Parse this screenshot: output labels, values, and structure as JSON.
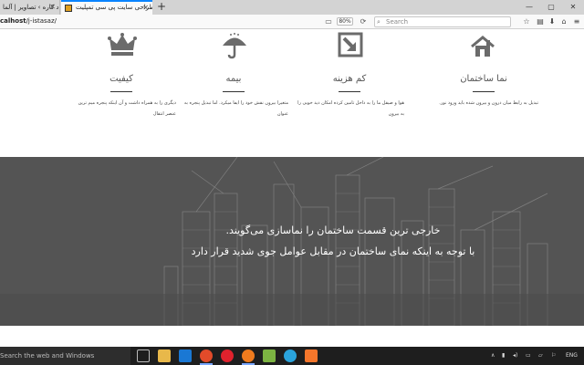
{
  "browser": {
    "tabs": [
      {
        "label": "ایجاد کاره › تصاویر | آلما"
      },
      {
        "label": "طراحی سایت پی سی تمپلیت"
      }
    ],
    "new_tab_symbol": "+",
    "window_controls": [
      "—",
      "▢",
      "✕"
    ],
    "url_bold": "calhost",
    "url_rest": "/j-istasaz/",
    "zoom": "80%",
    "search_placeholder": "Search"
  },
  "features": [
    {
      "icon": "house-icon",
      "title": "نما ساختمان",
      "desc": "تبدیل به رابط میان درون و بیرون شده باید ورود نور."
    },
    {
      "icon": "shrink-arrow-icon",
      "title": "کم هزینه",
      "desc": "هوا و صیقل ما را به داخل تامین کرده امکان دید خوبی را به بیرون"
    },
    {
      "icon": "umbrella-icon",
      "title": "بیمه",
      "desc": "متغیرا بیرون نقش خود را ایفا میکرد. اما تبدیل پنجره به عنوان"
    },
    {
      "icon": "crown-icon",
      "title": "کیفیت",
      "desc": "دیگری را به همراه داشت و آن اینکه پنجره میم ترین عنصر انتقال"
    }
  ],
  "banner": {
    "line1": "خارجی ترین قسمت ساختمان را نماسازی می‌گویند.",
    "line2": "با توجه به اینکه نمای ساختمان در مقابل عوامل جوی شدید قرار دارد"
  },
  "taskbar": {
    "search_text": "Search the web and Windows",
    "apps": [
      "task-view",
      "file-explorer",
      "edge",
      "chrome",
      "opera",
      "firefox",
      "android",
      "telegram",
      "xampp"
    ],
    "lang": "ENG"
  },
  "colors": {
    "banner_bg": "#545454",
    "tab_accent": "#0a84ff",
    "icon_gray": "#6b6b6b"
  }
}
